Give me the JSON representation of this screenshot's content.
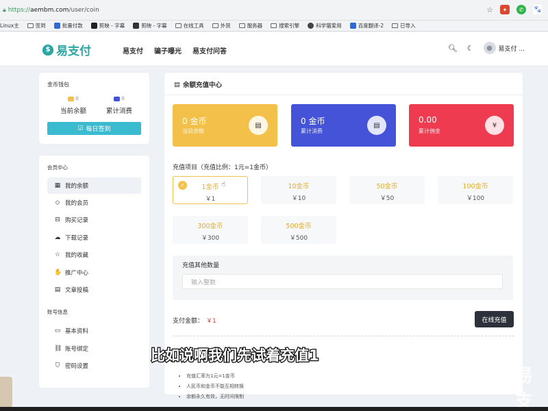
{
  "browser": {
    "url_scheme": "https://",
    "url_host": "aembm.com",
    "url_path": "/user/coin",
    "bookmarks": [
      {
        "label": "Linux主",
        "type": "text"
      },
      {
        "label": "签到",
        "type": "folder"
      },
      {
        "label": "批量付款",
        "type": "site"
      },
      {
        "label": "剪映 - 字幕",
        "type": "site"
      },
      {
        "label": "剪映 - 字幕",
        "type": "site"
      },
      {
        "label": "在线工具",
        "type": "folder"
      },
      {
        "label": "外贸",
        "type": "folder"
      },
      {
        "label": "服务器",
        "type": "folder"
      },
      {
        "label": "搜索引擎",
        "type": "folder"
      },
      {
        "label": "科学猫爱用",
        "type": "site"
      },
      {
        "label": "百度翻译-2",
        "type": "site"
      },
      {
        "label": "已导入",
        "type": "folder"
      }
    ]
  },
  "nav": {
    "logo": "易支付",
    "links": [
      "易支付",
      "骗子曝光",
      "易支付问答"
    ],
    "user": "易支付 ..."
  },
  "wallet": {
    "title": "金币钱包",
    "current_badge": "0",
    "current_label": "当前余额",
    "spent_badge": "0",
    "spent_label": "累计消费",
    "checkin": "每日签到"
  },
  "menu": {
    "section1": "会员中心",
    "items1": [
      "我的余额",
      "我的会员",
      "购买记录",
      "下载记录",
      "我的收藏",
      "推广中心",
      "文章投稿"
    ],
    "section2": "账号信息",
    "items2": [
      "基本资料",
      "账号绑定",
      "密码设置"
    ]
  },
  "main": {
    "heading": "余额充值中心",
    "balances": [
      {
        "value": "0 金币",
        "label": "当前余额",
        "color": "#f3c04a",
        "icon": "coin-stack-icon"
      },
      {
        "value": "0 金币",
        "label": "累计消费",
        "color": "#4553d9",
        "icon": "coin-stack-icon"
      },
      {
        "value": "0.00",
        "label": "累计佣金",
        "color": "#ee3b4f",
        "icon": "yen-icon"
      }
    ],
    "recharge_title": "充值项目（充值比例：1元=1金币）",
    "options": [
      {
        "gold": "1金币",
        "price": "￥1"
      },
      {
        "gold": "10金币",
        "price": "￥10"
      },
      {
        "gold": "50金币",
        "price": "￥50"
      },
      {
        "gold": "100金币",
        "price": "￥100"
      },
      {
        "gold": "300金币",
        "price": "￥300"
      },
      {
        "gold": "500金币",
        "price": "￥500"
      }
    ],
    "other_label": "充值其他数量",
    "other_placeholder": "输入整数",
    "pay_label": "支付金额：",
    "pay_amount": "￥1",
    "pay_button": "在线充值",
    "notes": [
      "充值汇率为1元=1金币",
      "人民币和金币不能互相转换",
      "余额永久有效，无时间限制"
    ]
  },
  "overlay": {
    "subtitle": "比如说啊我们先试着充值1",
    "watermark": "易支"
  }
}
